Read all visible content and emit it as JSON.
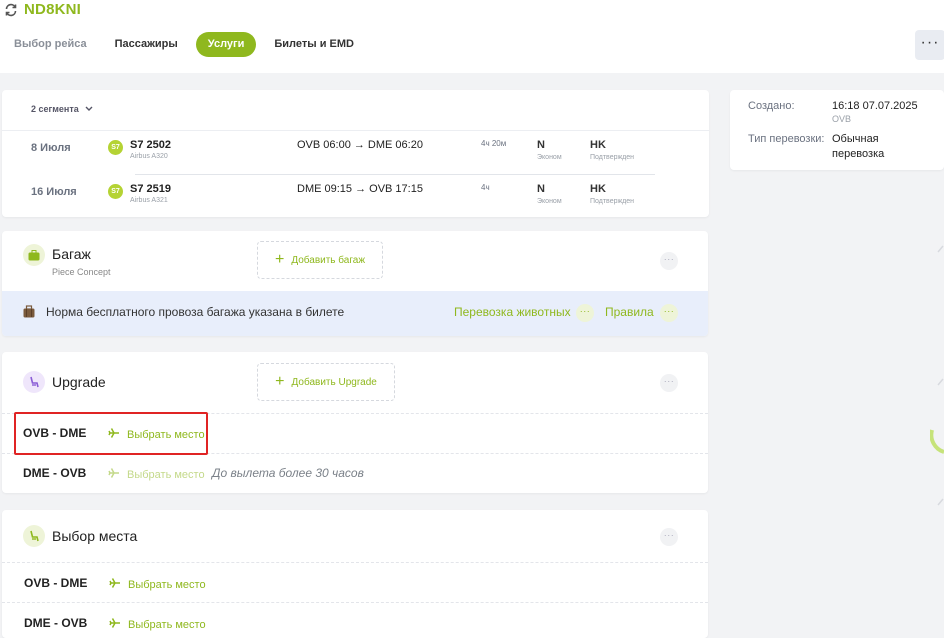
{
  "header": {
    "pnr": "ND8KNI",
    "tabs": [
      {
        "label": "Выбор рейса"
      },
      {
        "label": "Пассажиры"
      },
      {
        "label": "Услуги"
      },
      {
        "label": "Билеты и EMD"
      }
    ],
    "active_tab": "Услуги",
    "more": "···"
  },
  "segments": {
    "toggle": "2 сегмента",
    "rows": [
      {
        "date": "8 Июля",
        "airline_logo": "S7",
        "flight": "S7 2502",
        "aircraft": "Airbus A320",
        "route": "OVB 06:00 → DME 06:20",
        "duration": "4ч 20м",
        "class": "N",
        "class_name": "Эконом",
        "status": "HK",
        "status_name": "Подтвержден"
      },
      {
        "date": "16 Июля",
        "airline_logo": "S7",
        "flight": "S7 2519",
        "aircraft": "Airbus A321",
        "route": "DME 09:15 → OVB 17:15",
        "duration": "4ч",
        "class": "N",
        "class_name": "Эконом",
        "status": "HK",
        "status_name": "Подтвержден"
      }
    ]
  },
  "info": {
    "created_label": "Создано:",
    "created_value": "16:18 07.07.2025",
    "created_sub": "OVB",
    "type_label": "Тип перевозки:",
    "type_value_line1": "Обычная",
    "type_value_line2": "перевозка"
  },
  "baggage": {
    "title": "Багаж",
    "subtitle": "Piece Concept",
    "add_label": "Добавить багаж",
    "note": "Норма бесплатного провоза багажа указана в билете",
    "pets_link": "Перевозка животных",
    "rules_link": "Правила",
    "icon": "suitcase-icon"
  },
  "upgrade": {
    "title": "Upgrade",
    "add_label": "Добавить Upgrade",
    "icon": "seat-icon",
    "rows": [
      {
        "route": "OVB - DME",
        "action": "Выбрать место",
        "note": ""
      },
      {
        "route": "DME - OVB",
        "action": "Выбрать место",
        "note": "До вылета более 30 часов"
      }
    ]
  },
  "seat_selection": {
    "title": "Выбор места",
    "icon": "seat-icon",
    "rows": [
      {
        "route": "OVB - DME",
        "action": "Выбрать место"
      },
      {
        "route": "DME - OVB",
        "action": "Выбрать место"
      }
    ]
  },
  "colors": {
    "accent": "#8fb81e",
    "highlight_box": "#e02424",
    "band": "#e8eefb"
  }
}
